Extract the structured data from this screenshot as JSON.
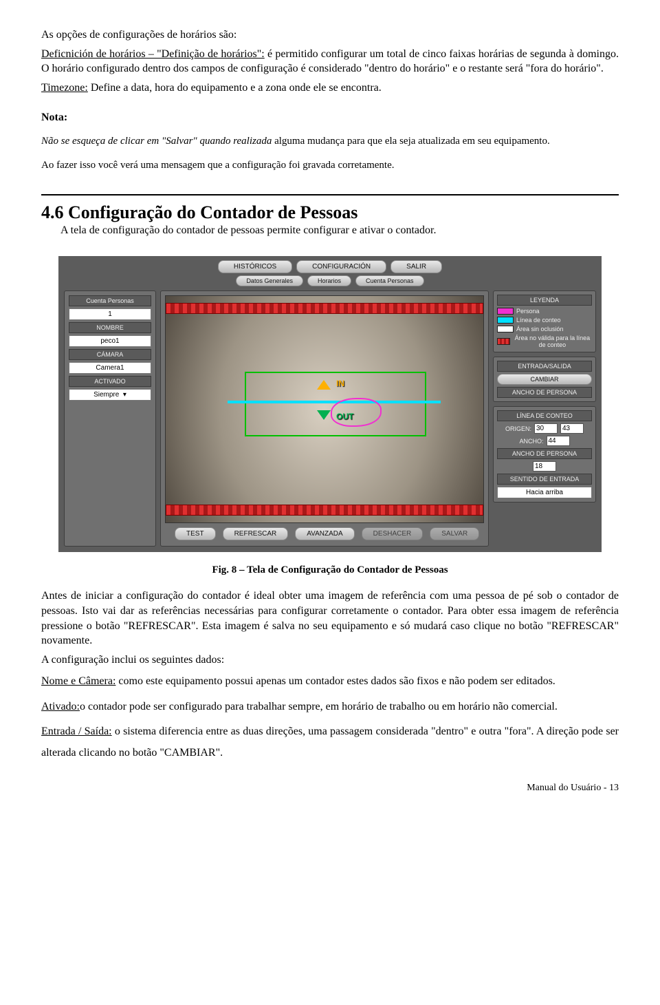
{
  "intro": {
    "line1": "As opções de configurações de horários são:",
    "defHead": "Deficnición de horários – \"Definição de horários\":",
    "defRest": " é permitido configurar um total de cinco faixas horárias de segunda à domingo. O horário configurado dentro dos campos de configuração é considerado \"dentro do horário\" e o restante será \"fora do horário\".",
    "tzHead": "Timezone:",
    "tzRest": " Define a data, hora do equipamento e a zona onde ele se encontra."
  },
  "note": {
    "head": "Nota:",
    "l1a": "Não se esqueça de clicar em \"Salvar\" quando realizada",
    "l1b": " alguma mudança para que ela seja atualizada em seu equipamento.",
    "l2": "Ao fazer isso você verá uma mensagem que a configuração foi gravada corretamente."
  },
  "section": {
    "title": "4.6 Configuração do Contador de Pessoas",
    "desc": "A tela de configuração do contador de pessoas permite configurar e ativar o contador."
  },
  "shot": {
    "topnav": [
      "HISTÓRICOS",
      "CONFIGURACIÓN",
      "SALIR"
    ],
    "subnav": [
      "Datos Generales",
      "Horarios",
      "Cuenta Personas"
    ],
    "left": {
      "l1": "Cuenta Personas",
      "v1": "1",
      "l2": "NOMBRE",
      "v2": "peco1",
      "l3": "CÁMARA",
      "v3": "Camera1",
      "l4": "ACTIVADO",
      "v4": "Siempre"
    },
    "bottom": [
      "TEST",
      "REFRESCAR",
      "AVANZADA",
      "DESHACER",
      "SALVAR"
    ],
    "legend": {
      "title": "LEYENDA",
      "r1": "Persona",
      "r2": "Línea de conteo",
      "r3": "Área sin oclusión",
      "r4": "Área no válida para la línea de conteo"
    },
    "es": {
      "title": "ENTRADA/SALIDA",
      "btn": "CAMBIAR",
      "ancho": "ANCHO DE PERSONA"
    },
    "lc": {
      "title": "LÍNEA DE CONTEO",
      "origen": "ORIGEN:",
      "o1": "30",
      "o2": "43",
      "anchoLbl": "ANCHO:",
      "ancho": "44",
      "apLbl": "ANCHO DE PERSONA",
      "ap": "18",
      "sentLbl": "SENTIDO DE ENTRADA",
      "sent": "Hacia arriba"
    },
    "in": "IN",
    "out": "OUT"
  },
  "caption": "Fig. 8 – Tela de Configuração do Contador de Pessoas",
  "after": {
    "p1": "Antes de iniciar a configuração do contador é ideal obter uma imagem de referência com uma pessoa de pé sob o contador de pessoas. Isto vai dar as referências necessárias para configurar corretamente o contador. Para obter essa imagem de referência pressione o botão \"REFRESCAR\". Esta imagem é salva no seu equipamento e só mudará caso clique no botão \"REFRESCAR\" novamente.",
    "p2": "A configuração inclui os seguintes dados:",
    "nc1u": "Nome e Câmera:",
    "nc1r": " como este equipamento possui apenas um contador estes dados são fixos e não podem ser editados.",
    "at1u": "Ativado:",
    "at1r": "o contador pode ser configurado para trabalhar sempre, em horário de trabalho ou em horário não comercial.",
    "es1u": "Entrada / Saída:",
    "es1r": " o sistema diferencia entre as duas direções, uma passagem considerada \"dentro\" e outra \"fora\". A direção pode ser alterada clicando no botão \"CAMBIAR\"."
  },
  "footer": "Manual do Usuário - 13"
}
